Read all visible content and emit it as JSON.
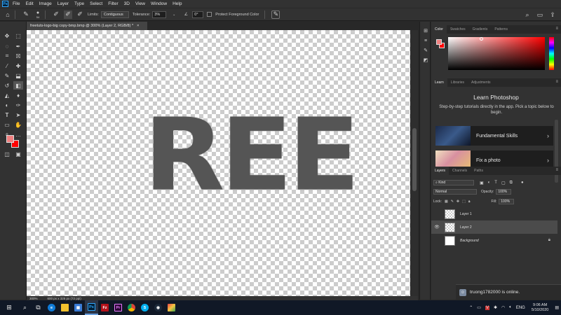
{
  "app": {
    "logo": "Ps"
  },
  "menu": [
    "File",
    "Edit",
    "Image",
    "Layer",
    "Type",
    "Select",
    "Filter",
    "3D",
    "View",
    "Window",
    "Help"
  ],
  "options": {
    "brush_size": "54",
    "limits_label": "Limits:",
    "limits_value": "Contiguous",
    "tolerance_label": "Tolerance:",
    "tolerance_value": "3%",
    "angle_value": "0°",
    "protect_label": "Protect Foreground Color"
  },
  "document": {
    "tab_title": "freetuts-logo-big copy-bmp.bmp @ 300% (Layer 2, RGB/8) *",
    "canvas_text": "REE",
    "zoom": "300%",
    "doc_info": "600 px x 325 px (72 ppi)"
  },
  "panels": {
    "color_tabs": [
      "Color",
      "Swatches",
      "Gradients",
      "Patterns"
    ],
    "learn_tabs": [
      "Learn",
      "Libraries",
      "Adjustments"
    ],
    "learn_title": "Learn Photoshop",
    "learn_desc": "Step-by-step tutorials directly in the app. Pick a topic below to begin.",
    "learn_cards": [
      "Fundamental Skills",
      "Fix a photo"
    ],
    "layers_tabs": [
      "Layers",
      "Channels",
      "Paths"
    ],
    "filter_kind": "Kind",
    "blend_mode": "Normal",
    "opacity_label": "Opacity:",
    "opacity_value": "100%",
    "lock_label": "Lock:",
    "fill_label": "Fill:",
    "fill_value": "100%",
    "layers": [
      {
        "name": "Layer 1",
        "visible": false,
        "selected": false
      },
      {
        "name": "Layer 2",
        "visible": true,
        "selected": true
      },
      {
        "name": "Background",
        "visible": false,
        "selected": false,
        "locked": true
      }
    ]
  },
  "colors": {
    "foreground": "#f08080",
    "background": "#ff0000",
    "accent": "#31a8ff"
  },
  "notification": {
    "user": "truong1782000",
    "text": "truong1782000 is online."
  },
  "taskbar": {
    "language": "ENG",
    "time": "9:06 AM",
    "date": "5/10/2020"
  }
}
